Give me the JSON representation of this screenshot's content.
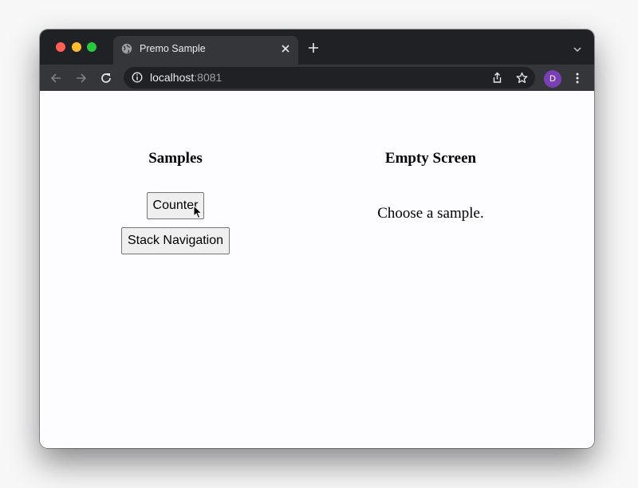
{
  "browser": {
    "tab_title": "Premo Sample",
    "url_host": "localhost",
    "url_port": ":8081",
    "profile_initial": "D",
    "colors": {
      "close": "#ff5f57",
      "minimize": "#febc2e",
      "maximize": "#28c840",
      "profile": "#7b3fb5"
    }
  },
  "left": {
    "heading": "Samples",
    "buttons": [
      {
        "label": "Counter"
      },
      {
        "label": "Stack Navigation"
      }
    ]
  },
  "right": {
    "heading": "Empty Screen",
    "message": "Choose a sample."
  }
}
